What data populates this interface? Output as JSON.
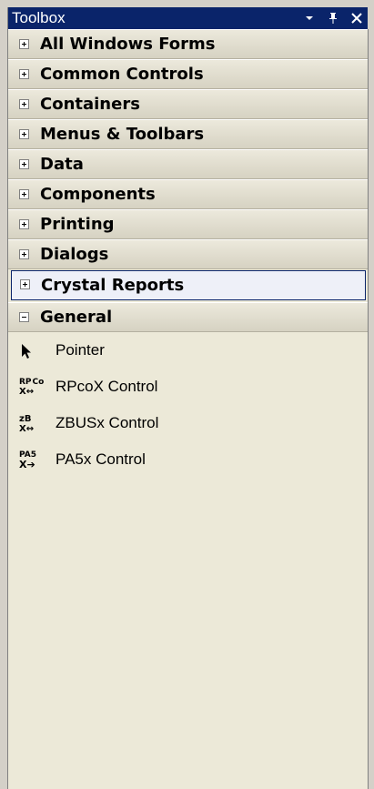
{
  "window": {
    "title": "Toolbox",
    "buttons": {
      "dropdown_icon": "chevron-down-icon",
      "pin_icon": "pin-icon",
      "close_icon": "close-icon"
    }
  },
  "tabs": [
    {
      "label": "All Windows Forms",
      "expanded": false
    },
    {
      "label": "Common Controls",
      "expanded": false
    },
    {
      "label": "Containers",
      "expanded": false
    },
    {
      "label": "Menus & Toolbars",
      "expanded": false
    },
    {
      "label": "Data",
      "expanded": false
    },
    {
      "label": "Components",
      "expanded": false
    },
    {
      "label": "Printing",
      "expanded": false
    },
    {
      "label": "Dialogs",
      "expanded": false
    },
    {
      "label": "Crystal Reports",
      "expanded": false,
      "selected": true
    },
    {
      "label": "General",
      "expanded": true
    }
  ],
  "general_items": [
    {
      "label": "Pointer",
      "icon": "pointer-icon"
    },
    {
      "label": "RPcoX Control",
      "icon": "rpcox-control-icon",
      "icon_text": [
        "RP",
        "Co",
        "X"
      ]
    },
    {
      "label": "ZBUSx Control",
      "icon": "zbusx-control-icon",
      "icon_text": [
        "zB",
        "",
        "X"
      ]
    },
    {
      "label": "PA5x Control",
      "icon": "pa5x-control-icon",
      "icon_text": [
        "PA5",
        "",
        "X"
      ]
    }
  ],
  "colors": {
    "titlebar": "#0a246a",
    "panel": "#ece9d8",
    "selected_border": "#0a246a"
  }
}
